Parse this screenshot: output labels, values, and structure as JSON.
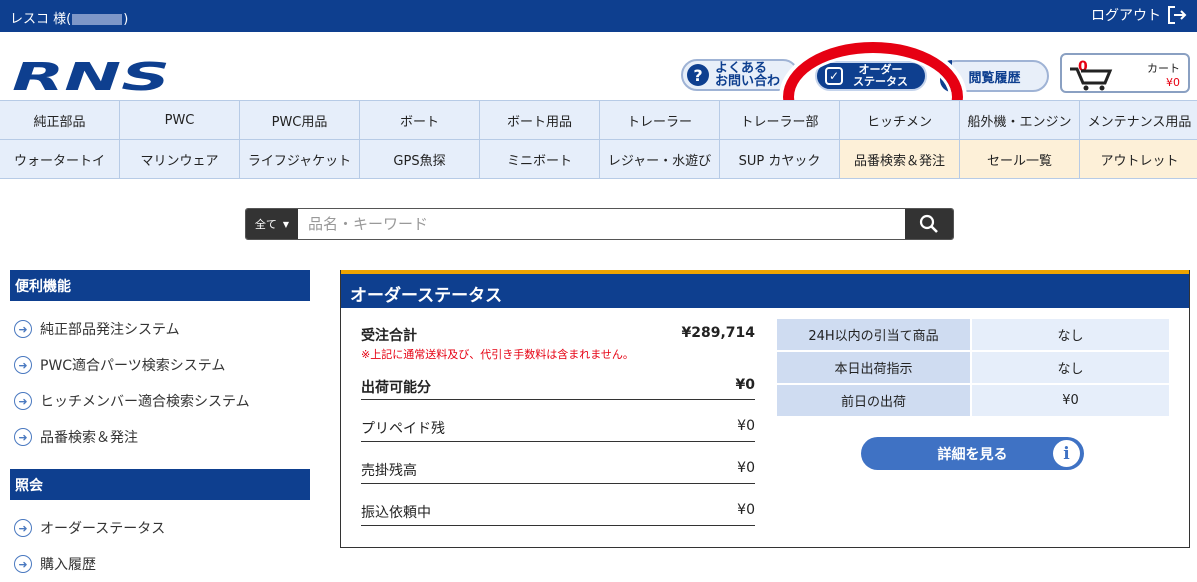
{
  "topbar": {
    "user_label": "レスコ 様(",
    "user_close": ")",
    "logout": "ログアウト"
  },
  "header": {
    "logo": "RNS",
    "faq": "よくある\nお問い合わ",
    "order_status": "オーダー\nステータス",
    "history": "閲覧履歴",
    "cart": {
      "count": "0",
      "label": "カート",
      "price": "¥0"
    }
  },
  "nav": [
    "純正部品",
    "PWC",
    "PWC用品",
    "ボート",
    "ボート用品",
    "トレーラー",
    "トレーラー部",
    "ヒッチメン",
    "船外機・エンジン",
    "メンテナンス用品",
    "ウォータートイ",
    "マリンウェア",
    "ライフジャケット",
    "GPS魚探",
    "ミニボート",
    "レジャー・水遊び",
    "SUP カヤック",
    "品番検索＆発注",
    "セール一覧",
    "アウトレット"
  ],
  "search": {
    "category": "全て",
    "placeholder": "品名・キーワード"
  },
  "sidebar": {
    "sections": [
      {
        "title": "便利機能",
        "items": [
          "純正部品発注システム",
          "PWC適合パーツ検索システム",
          "ヒッチメンバー適合検索システム",
          "品番検索＆発注"
        ]
      },
      {
        "title": "照会",
        "items": [
          "オーダーステータス",
          "購入履歴"
        ]
      }
    ]
  },
  "panel": {
    "title": "オーダーステータス",
    "order_total_label": "受注合計",
    "order_total_value": "¥289,714",
    "note": "※上記に通常送料及び、代引き手数料は含まれません。",
    "shippable_label": "出荷可能分",
    "shippable_value": "¥0",
    "rows": [
      {
        "label": "プリペイド残",
        "value": "¥0"
      },
      {
        "label": "売掛残高",
        "value": "¥0"
      },
      {
        "label": "振込依頼中",
        "value": "¥0"
      }
    ],
    "table": [
      {
        "label": "24H以内の引当て商品",
        "value": "なし"
      },
      {
        "label": "本日出荷指示",
        "value": "なし"
      },
      {
        "label": "前日の出荷",
        "value": "¥0"
      }
    ],
    "detail_button": "詳細を見る"
  },
  "colors": {
    "brand": "#0e3f8f",
    "accent": "#f0a400",
    "alert": "#e60012"
  }
}
